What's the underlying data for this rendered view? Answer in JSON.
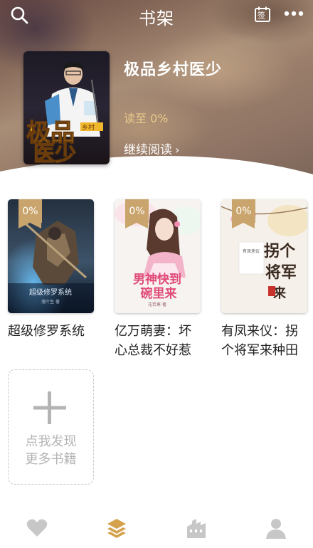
{
  "header": {
    "title": "书架",
    "icons": [
      "search-icon",
      "calendar-sign-icon",
      "more-icon"
    ],
    "calendar_glyph": "签"
  },
  "current_book": {
    "title": "极品乡村医少",
    "progress": "读至 0%",
    "continue_label": "继续阅读",
    "cover_text": "极品医少"
  },
  "shelf": {
    "books": [
      {
        "title": "超级修罗系统",
        "progress": "0%",
        "cover_caption": "超级修罗系统"
      },
      {
        "title": "亿万萌妻：坏心总裁不好惹",
        "progress": "0%",
        "cover_caption": "男神快到碗里来"
      },
      {
        "title": "有凤来仪：拐个将军来种田",
        "progress": "0%",
        "cover_caption": "拐个将军"
      }
    ],
    "discover_label": "点我发现更多书籍"
  },
  "bottom_nav": {
    "items": [
      "heart-icon",
      "bookshelf-icon",
      "bookstore-icon",
      "profile-icon"
    ],
    "active": "bookshelf-icon",
    "active_color": "#d4a14c",
    "inactive_color": "#c7c7c7"
  },
  "colors": {
    "accent": "#c9a46c",
    "progress_text": "#e8c98c"
  }
}
